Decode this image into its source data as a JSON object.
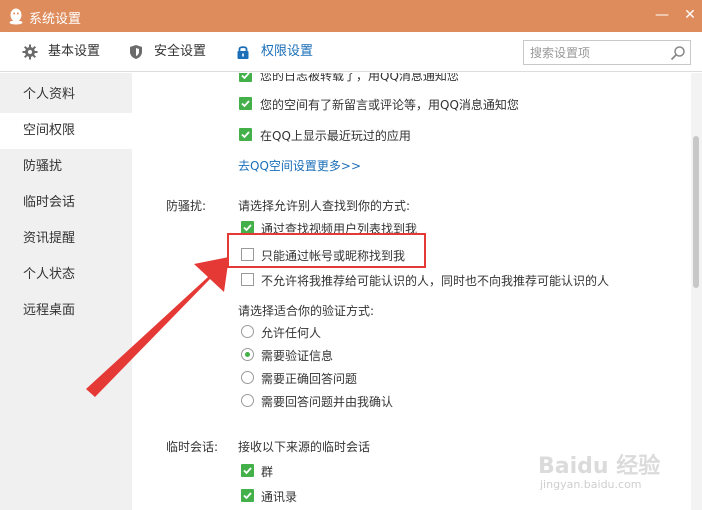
{
  "window": {
    "title": "系统设置",
    "minimize_label": "—",
    "close_label": "✕"
  },
  "toolbar": {
    "tabs": [
      {
        "label": "基本设置",
        "icon": "gear-icon"
      },
      {
        "label": "安全设置",
        "icon": "shield-icon"
      },
      {
        "label": "权限设置",
        "icon": "lock-icon",
        "active": true
      }
    ]
  },
  "search": {
    "placeholder": "搜索设置项",
    "value": ""
  },
  "sidebar": {
    "items": [
      {
        "label": "个人资料"
      },
      {
        "label": "空间权限",
        "active": true
      },
      {
        "label": "防骚扰"
      },
      {
        "label": "临时会话"
      },
      {
        "label": "资讯提醒"
      },
      {
        "label": "个人状态"
      },
      {
        "label": "远程桌面"
      }
    ]
  },
  "space": {
    "options": [
      {
        "label": "您的日志被转载了，用QQ消息通知您",
        "checked": true
      },
      {
        "label": "您的空间有了新留言或评论等，用QQ消息通知您",
        "checked": true
      },
      {
        "label": "在QQ上显示最近玩过的应用",
        "checked": true
      }
    ],
    "more_link": "去QQ空间设置更多>>"
  },
  "harass": {
    "label": "防骚扰:",
    "find_prompt": "请选择允许别人查找到你的方式:",
    "find_options": [
      {
        "label": "通过查找视频用户列表找到我",
        "checked": true
      },
      {
        "label": "只能通过帐号或昵称找到我",
        "checked": false
      },
      {
        "label": "不允许将我推荐给可能认识的人，同时也不向我推荐可能认识的人",
        "checked": false
      }
    ],
    "verify_prompt": "请选择适合你的验证方式:",
    "verify_options": [
      {
        "label": "允许任何人",
        "selected": false
      },
      {
        "label": "需要验证信息",
        "selected": true
      },
      {
        "label": "需要正确回答问题",
        "selected": false
      },
      {
        "label": "需要回答问题并由我确认",
        "selected": false
      }
    ]
  },
  "temp_chat": {
    "label": "临时会话:",
    "prompt": "接收以下来源的临时会话",
    "options": [
      {
        "label": "群",
        "checked": true
      },
      {
        "label": "通讯录",
        "checked": true
      }
    ]
  },
  "annotation": {
    "highlight_color": "#e53935"
  },
  "watermark": {
    "text": "Baidu 经验",
    "url": "jingyan.baidu.com"
  },
  "colors": {
    "titlebar": "#de8c5c",
    "accent": "#1a6fb8",
    "check": "#43b04a",
    "sidebar_bg": "#f0f0f0"
  }
}
